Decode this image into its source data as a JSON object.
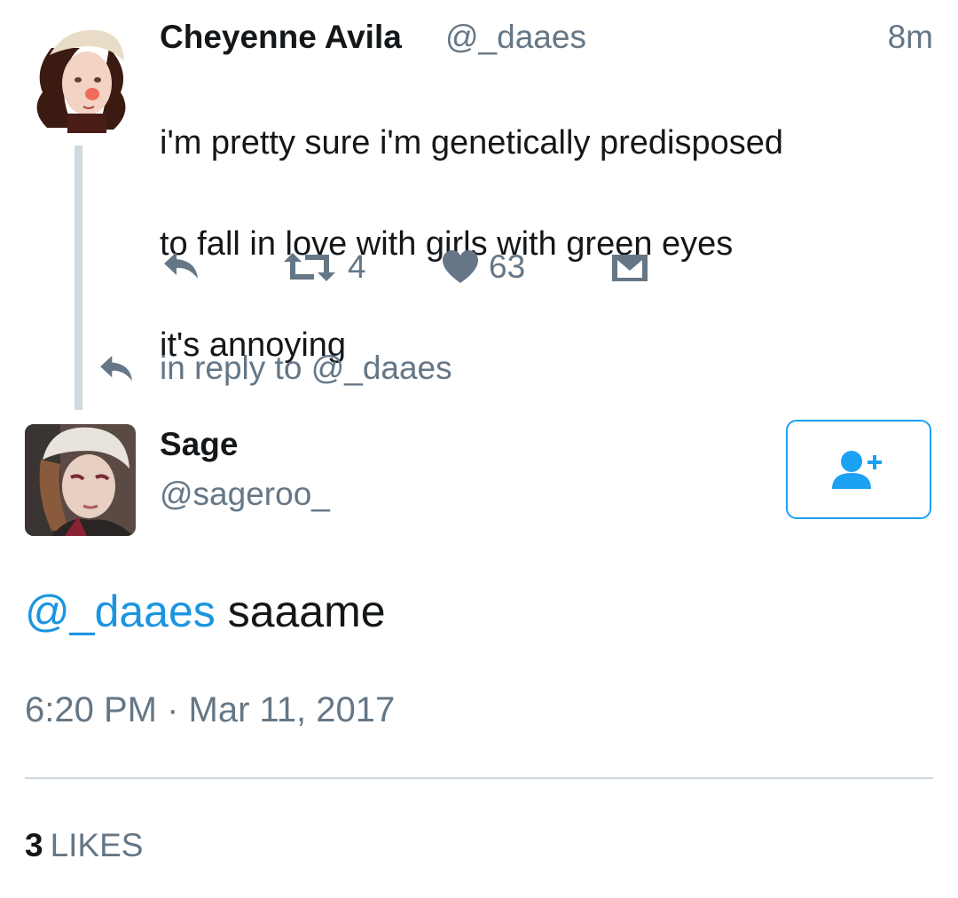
{
  "parent_tweet": {
    "name": "Cheyenne Avila",
    "handle": "@_daaes",
    "time": "8m",
    "text_lines": [
      "i'm pretty sure i'm genetically predisposed",
      "to fall in love with girls with green eyes",
      "it's annoying"
    ],
    "retweets": "4",
    "likes": "63",
    "in_reply_text": "in reply to @_daaes"
  },
  "reply_tweet": {
    "name": "Sage",
    "handle": "@sageroo_",
    "mention": "@_daaes",
    "text": " saaame",
    "timestamp": "6:20 PM · Mar 11, 2017",
    "likes_count": "3",
    "likes_label": "LIKES"
  },
  "colors": {
    "accent": "#1da1f2",
    "mention": "#1b95e0",
    "secondary_text": "#657786",
    "thread_line": "#cfd9de"
  },
  "icons": {
    "reply": "reply-icon",
    "retweet": "retweet-icon",
    "like": "heart-icon",
    "dm": "envelope-icon",
    "follow": "add-user-icon"
  }
}
